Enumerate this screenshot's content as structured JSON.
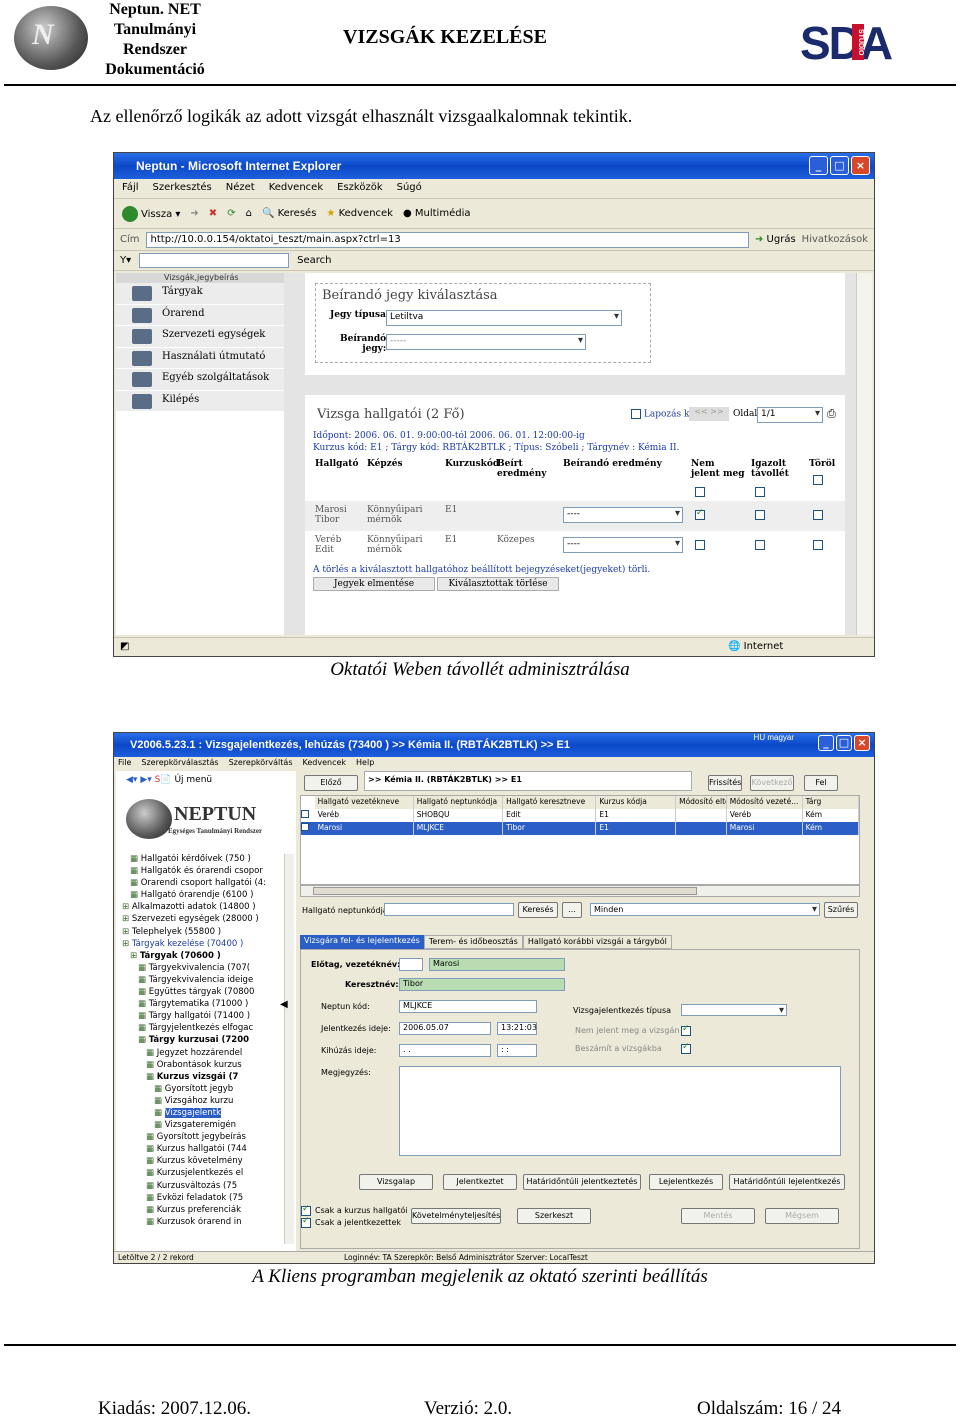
{
  "header": {
    "logo_letters": "N",
    "system_lines": [
      "Neptun. NET",
      "Tanulmányi",
      "Rendszer",
      "Dokumentáció"
    ],
    "title": "VIZSGÁK KEZELÉSE",
    "right_logo": {
      "letters": "SDA",
      "badge": "STUDIO"
    }
  },
  "intro_text": "Az ellenőrző logikák az adott vizsgát elhasznált vizsgaalkalomnak tekintik.",
  "screenshot1": {
    "window_title": "Neptun - Microsoft Internet Explorer",
    "menu": [
      "Fájl",
      "Szerkesztés",
      "Nézet",
      "Kedvencek",
      "Eszközök",
      "Súgó"
    ],
    "toolbar": [
      "Vissza",
      "Keresés",
      "Kedvencek",
      "Multimédia"
    ],
    "address_label": "Cím",
    "address_url": "http://10.0.0.154/oktatoi_teszt/main.aspx?ctrl=13",
    "go_label": "Ugrás",
    "links_label": "Hivatkozások",
    "search_label": "Search",
    "sidebar_top": "Vizsgák,jegybeírás",
    "sidebar": [
      "Tárgyak",
      "Órarend",
      "Szervezeti egységek",
      "Használati útmutató",
      "Egyéb szolgáltatások",
      "Kilépés"
    ],
    "grade_panel": {
      "title": "Beírandó jegy kiválasztása",
      "type_label": "Jegy típusa:",
      "type_value": "Letiltva",
      "grade_label1": "Beírandó",
      "grade_label2": "jegy:",
      "grade_value": "-----"
    },
    "students_panel": {
      "title": "Vizsga hallgatói (2 Fő)",
      "paging_label": "Lapozás ki",
      "page_label": "Oldal",
      "page_value": "1/1",
      "time_line": "Időpont: 2006. 06. 01. 9:00:00-tól 2006. 06. 01. 12:00:00-ig",
      "course_line": "Kurzus kód: E1 ; Tárgy kód: RBTÁK2BTLK ; Típus: Szóbeli ; Tárgynév : Kémia II.",
      "columns": [
        "Hallgató",
        "Képzés",
        "Kurzuskód",
        "Beírt eredmény",
        "Beírandó eredmény",
        "Nem jelent meg",
        "Igazolt távollét",
        "Töröl"
      ],
      "rows": [
        {
          "student": "Marosi Tibor",
          "training": "Könnyűipari mérnök",
          "course": "E1",
          "grade": "",
          "new_grade": "----",
          "absent": true,
          "excused": false,
          "delete": false
        },
        {
          "student": "Veréb Edit",
          "training": "Könnyűipari mérnök",
          "course": "E1",
          "grade": "Közepes",
          "new_grade": "----",
          "absent": false,
          "excused": false,
          "delete": false
        }
      ],
      "note": "A törlés a kiválasztott hallgatóhoz beállított bejegyzéseket(jegyeket) törli.",
      "buttons": [
        "Jegyek elmentése",
        "Kiválasztottak törlése"
      ]
    },
    "status_right": "Internet"
  },
  "caption1": "Oktatói Weben távollét adminisztrálása",
  "screenshot2": {
    "window_title": "V2006.5.23.1 : Vizsgajelentkezés, lehúzás (73400 ) >> Kémia II. (RBTÁK2BTLK) >> E1",
    "lang": "HU magyar",
    "menu": [
      "File",
      "Szerepkörválasztás",
      "Szerepkörváltás",
      "Kedvencek",
      "Help"
    ],
    "new_window": "Új menü",
    "logo_name": "NEPTUN",
    "logo_sub": "Egységes Tanulmányi Rendszer",
    "tree": [
      "Hallgatói kérdőívek (750 )",
      "Hallgatók és órarendi csopor",
      "Órarendi csoport hallgatói (4:",
      "Hallgató órarendje (6100 )",
      "Alkalmazotti adatok (14800 )",
      "Szervezeti egységek (28000 )",
      "Telephelyek (55800 )",
      "Tárgyak kezelése (70400 )",
      "Tárgyak (70600 )",
      "Tárgyekvivalencia (707(",
      "Tárgyekvivalencia ideige",
      "Együttes tárgyak (70800",
      "Tárgytematika (71000 )",
      "Tárgy hallgatói (71400 )",
      "Tárgyjelentkezés elfogac",
      "Tárgy kurzusai (7200",
      "Jegyzet hozzárendel",
      "Órabontások kurzus",
      "Kurzus vizsgái (7",
      "Gyorsított jegyb",
      "Vizsgához kurzu",
      "Vizsgajelentk",
      "Vizsgateremigén",
      "Gyorsított jegybeírás",
      "Kurzus hallgatói (744",
      "Kurzus követelmény",
      "Kurzusjelentkezés el",
      "Kurzusváltozás (75",
      "Évközi feladatok (75",
      "Kurzus preferenciák",
      "Kurzusok órarend in"
    ],
    "nav": {
      "prev": "Előző",
      "path": ">> Kémia II. (RBTÁK2BTLK) >> E1",
      "refresh": "Frissítés",
      "next": "Következő",
      "up": "Fel"
    },
    "grid_headers": [
      "Hallgató vezetékneve",
      "Hallgató neptunkódja",
      "Hallgató keresztneve",
      "Kurzus kódja",
      "Módosító eltolagja",
      "Módosító vezeté...",
      "Tárg"
    ],
    "grid_rows": [
      [
        "Veréb",
        "SHOBQU",
        "Edit",
        "E1",
        "",
        "Veréb",
        "Kém"
      ],
      [
        "Marosi",
        "MLJKCE",
        "Tibor",
        "E1",
        "",
        "Marosi",
        "Kém"
      ]
    ],
    "search": {
      "label": "Hallgató neptunkódja",
      "button": "Keresés",
      "dots": "...",
      "filter": "Minden",
      "filter_button": "Szűrés"
    },
    "tabs": [
      "Vizsgára fel- és lejelentkezés",
      "Terem- és időbeosztás",
      "Hallgató korábbi vizsgái a tárgyból"
    ],
    "form": {
      "prefix_label": "Előtag, vezetéknév:",
      "surname": "Marosi",
      "firstname_label": "Keresztnév:",
      "firstname": "Tibor",
      "code_label": "Neptun kód:",
      "code": "MLJKCE",
      "signup_label": "Jelentkezés ideje:",
      "signup_date": "2006.05.07",
      "signup_time": "13:21:03",
      "withdraw_label": "Kihúzás ideje:",
      "withdraw_date": ". .",
      "withdraw_time": ": :",
      "note_label": "Megjegyzés:",
      "type_label": "Vizsgajelentkezés típusa",
      "absent_label": "Nem jelent meg a vizsgán",
      "counts_label": "Beszámít a vizsgákba"
    },
    "buttons_row": [
      "Vizsgalap",
      "Jelentkeztet",
      "Határidőntúli jelentkeztetés",
      "Lejelentkezés",
      "Határidőntúli lejelentkezés"
    ],
    "bottom": {
      "only_course": "Csak a kurzus hallgatói",
      "only_signed": "Csak a jelentkezettek",
      "req_fulfil": "Követelményteljesítés",
      "edit": "Szerkeszt",
      "save": "Mentés",
      "cancel": "Mégsem"
    },
    "statusbar": [
      "Letöltve 2 / 2 rekord",
      "Loginnév: TA   Szerepkör: Belső Adminisztrátor   Szerver: LocalTeszt"
    ]
  },
  "caption2": "A Kliens programban megjelenik az oktató szerinti beállítás",
  "footer": {
    "edition": "Kiadás: 2007.12.06.",
    "version": "Verzió: 2.0.",
    "page": "Oldalszám: 16 / 24"
  }
}
